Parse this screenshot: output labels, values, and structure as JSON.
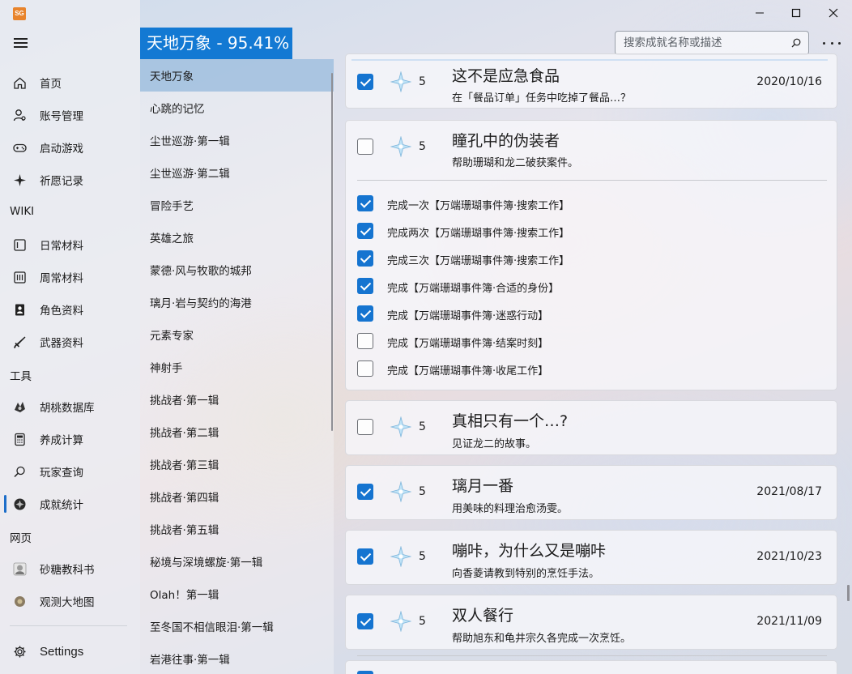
{
  "app": {
    "icon_text": "SG",
    "colors": {
      "accent": "#1379d3",
      "checkbox_on": "#1574d0"
    }
  },
  "nav": {
    "items": [
      {
        "label": "首页",
        "icon": "home-icon"
      },
      {
        "label": "账号管理",
        "icon": "user-settings-icon"
      },
      {
        "label": "启动游戏",
        "icon": "gamepad-icon"
      },
      {
        "label": "祈愿记录",
        "icon": "sparkle-icon"
      }
    ],
    "sections": {
      "wiki": "WIKI",
      "tools": "工具",
      "web": "网页"
    },
    "wiki_items": [
      {
        "label": "日常材料",
        "icon": "calendar-day-icon"
      },
      {
        "label": "周常材料",
        "icon": "calendar-week-icon"
      },
      {
        "label": "角色资料",
        "icon": "character-icon"
      },
      {
        "label": "武器资料",
        "icon": "weapon-icon"
      }
    ],
    "tool_items": [
      {
        "label": "胡桃数据库",
        "icon": "hutao-icon"
      },
      {
        "label": "养成计算",
        "icon": "calculator-icon"
      },
      {
        "label": "玩家查询",
        "icon": "search-icon"
      },
      {
        "label": "成就统计",
        "icon": "achievement-icon"
      }
    ],
    "web_items": [
      {
        "label": "砂糖教科书",
        "icon": "sucrose-icon"
      },
      {
        "label": "观测大地图",
        "icon": "map-icon"
      }
    ],
    "settings": "Settings"
  },
  "header": {
    "goal_title": "天地万象 - 95.41%",
    "search_placeholder": "搜索成就名称或描述"
  },
  "goals": [
    "天地万象",
    "心跳的记忆",
    "尘世巡游·第一辑",
    "尘世巡游·第二辑",
    "冒险手艺",
    "英雄之旅",
    "蒙德·风与牧歌的城邦",
    "璃月·岩与契约的海港",
    "元素专家",
    "神射手",
    "挑战者·第一辑",
    "挑战者·第二辑",
    "挑战者·第三辑",
    "挑战者·第四辑",
    "挑战者·第五辑",
    "秘境与深境螺旋·第一辑",
    "Olah！第一辑",
    "至冬国不相信眼泪·第一辑",
    "岩港往事·第一辑"
  ],
  "achievements": [
    {
      "title": "这不是应急食品",
      "desc": "在「餐品订单」任务中吃掉了餐品…？",
      "points": "5",
      "date": "2020/10/16",
      "checked": true
    },
    {
      "title": "瞳孔中的伪装者",
      "desc": "帮助珊瑚和龙二破获案件。",
      "points": "5",
      "date": "",
      "checked": false,
      "subtasks": [
        {
          "label": "完成一次【万端珊瑚事件簿·搜索工作】",
          "checked": true
        },
        {
          "label": "完成两次【万端珊瑚事件簿·搜索工作】",
          "checked": true
        },
        {
          "label": "完成三次【万端珊瑚事件簿·搜索工作】",
          "checked": true
        },
        {
          "label": "完成【万端珊瑚事件簿·合适的身份】",
          "checked": true
        },
        {
          "label": "完成【万端珊瑚事件簿·迷惑行动】",
          "checked": true
        },
        {
          "label": "完成【万端珊瑚事件簿·结案时刻】",
          "checked": false
        },
        {
          "label": "完成【万端珊瑚事件簿·收尾工作】",
          "checked": false
        }
      ]
    },
    {
      "title": "真相只有一个…?",
      "desc": "见证龙二的故事。",
      "points": "5",
      "date": "",
      "checked": false
    },
    {
      "title": "璃月一番",
      "desc": "用美味的料理治愈汤雯。",
      "points": "5",
      "date": "2021/08/17",
      "checked": true
    },
    {
      "title": "嘣咔，为什么又是嘣咔",
      "desc": "向香菱请教到特别的烹饪手法。",
      "points": "5",
      "date": "2021/10/23",
      "checked": true
    },
    {
      "title": "双人餐行",
      "desc": "帮助旭东和龟井宗久各完成一次烹饪。",
      "points": "5",
      "date": "2021/11/09",
      "checked": true
    }
  ]
}
